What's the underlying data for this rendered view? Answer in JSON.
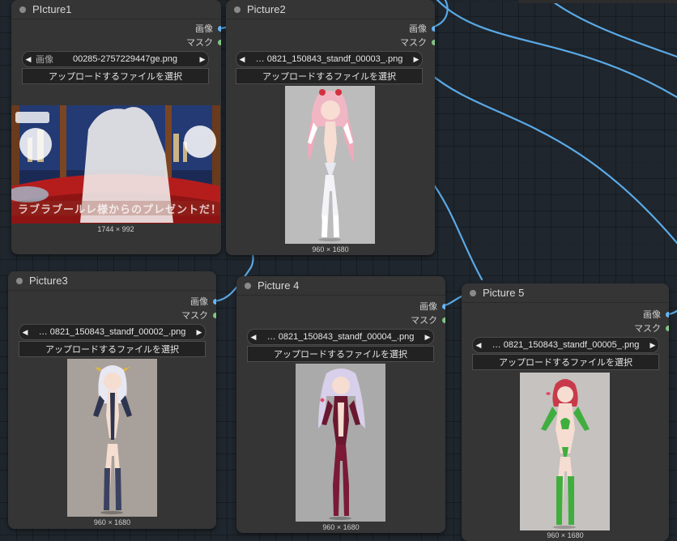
{
  "outputs": {
    "image_label": "画像",
    "mask_label": "マスク"
  },
  "upload_label": "アップロードするファイルを選択",
  "combo_label": "画像",
  "colors": {
    "image_slot": "#64b5f6",
    "mask_slot": "#81c784",
    "link": "#5aa9e6"
  },
  "nodes": [
    {
      "title": "PIcture1",
      "file": "00285-2757229447ge.png",
      "dims": "1744 × 992",
      "overlay_text": "ラブラブールレ様からのプレゼントだ！",
      "figure_color": "none"
    },
    {
      "title": "Picture2",
      "file": "… 0821_150843_standf_00003_.png",
      "dims": "960 × 1680",
      "figure_color": "pink"
    },
    {
      "title": "Picture3",
      "file": "… 0821_150843_standf_00002_.png",
      "dims": "960 × 1680",
      "figure_color": "navy"
    },
    {
      "title": "Picture 4",
      "file": "… 0821_150843_standf_00004_.png",
      "dims": "960 × 1680",
      "figure_color": "burgundy"
    },
    {
      "title": "Picture 5",
      "file": "… 0821_150843_standf_00005_.png",
      "dims": "960 × 1680",
      "figure_color": "green"
    }
  ]
}
